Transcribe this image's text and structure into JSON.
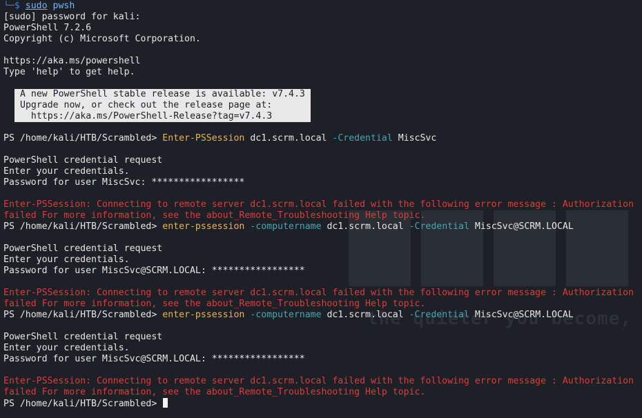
{
  "colors": {
    "background": "#1d2026",
    "text": "#e6e6e6",
    "prompt_blue": "#3b7ee0",
    "command_yellow": "#e7b45a",
    "parameter_teal": "#46a5b5",
    "error_red": "#e23a3a"
  },
  "top": {
    "corner": "└─",
    "dollar": "$",
    "sudo": "sudo",
    "pwsh": "pwsh"
  },
  "header": {
    "sudo_prompt": "[sudo] password for kali:",
    "version": "PowerShell 7.2.6",
    "copyright": "Copyright (c) Microsoft Corporation.",
    "url": "https://aka.ms/powershell",
    "help": "Type 'help' to get help."
  },
  "notice": {
    "line1": "A new PowerShell stable release is available: v7.4.3",
    "line2": "Upgrade now, or check out the release page at:",
    "line3": "  https://aka.ms/PowerShell-Release?tag=v7.4.3"
  },
  "ps_prompt": "PS /home/kali/HTB/Scrambled>",
  "attempts": [
    {
      "cmd": "Enter-PSSession",
      "param1": "",
      "target": "dc1.scrm.local",
      "param2": "-Credential",
      "user": "MiscSvc",
      "cred_request": "PowerShell credential request",
      "enter_creds": "Enter your credentials.",
      "password_line": "Password for user MiscSvc: *****************",
      "error1": "Enter-PSSession: Connecting to remote server dc1.scrm.local failed with the following error message : Authorization",
      "error2": "failed For more information, see the about_Remote_Troubleshooting Help topic."
    },
    {
      "cmd": "enter-pssession",
      "param1": "-computername",
      "target": "dc1.scrm.local",
      "param2": "-Credential",
      "user": "MiscSvc@SCRM.LOCAL",
      "cred_request": "PowerShell credential request",
      "enter_creds": "Enter your credentials.",
      "password_line": "Password for user MiscSvc@SCRM.LOCAL: *****************",
      "error1": "Enter-PSSession: Connecting to remote server dc1.scrm.local failed with the following error message : Authorization",
      "error2": "failed For more information, see the about_Remote_Troubleshooting Help topic."
    },
    {
      "cmd": "enter-pssession",
      "param1": "-computername",
      "target": "dc1.scrm.local",
      "param2": "-Credential",
      "user": "MiscSvc@SCRM.LOCAL",
      "cred_request": "PowerShell credential request",
      "enter_creds": "Enter your credentials.",
      "password_line": "Password for user MiscSvc@SCRM.LOCAL: *****************",
      "error1": "Enter-PSSession: Connecting to remote server dc1.scrm.local failed with the following error message : Authorization",
      "error2": "failed For more information, see the about_Remote_Troubleshooting Help topic."
    }
  ],
  "watermark": {
    "tagline": "the quieter you become, t"
  }
}
